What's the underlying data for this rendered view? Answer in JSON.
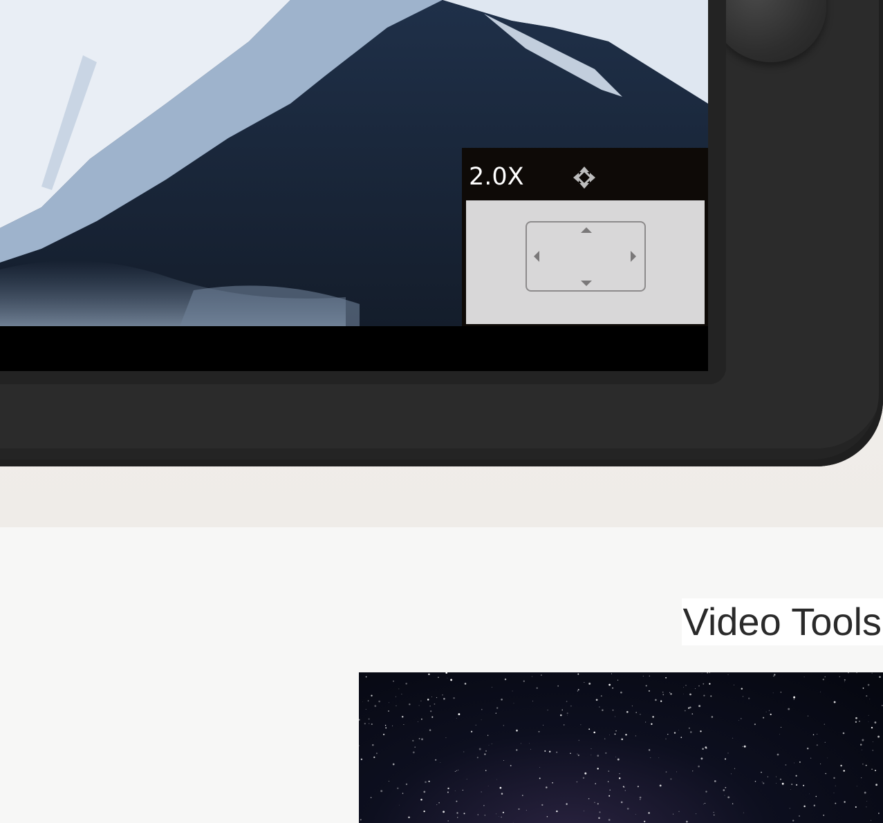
{
  "monitor": {
    "zoom_level": "2.0X",
    "zoom_move_icon": "move-arrows-icon",
    "pan_controls": {
      "up_icon": "triangle-up-icon",
      "down_icon": "triangle-down-icon",
      "left_icon": "triangle-left-icon",
      "right_icon": "triangle-right-icon"
    }
  },
  "sections": {
    "video_tools_title": "Video Tools"
  },
  "colors": {
    "device_body": "#2b2b2b",
    "zoom_header": "#0e0a07",
    "minimap_bg": "#d8d7d8",
    "page_bg": "#f7f7f6"
  }
}
